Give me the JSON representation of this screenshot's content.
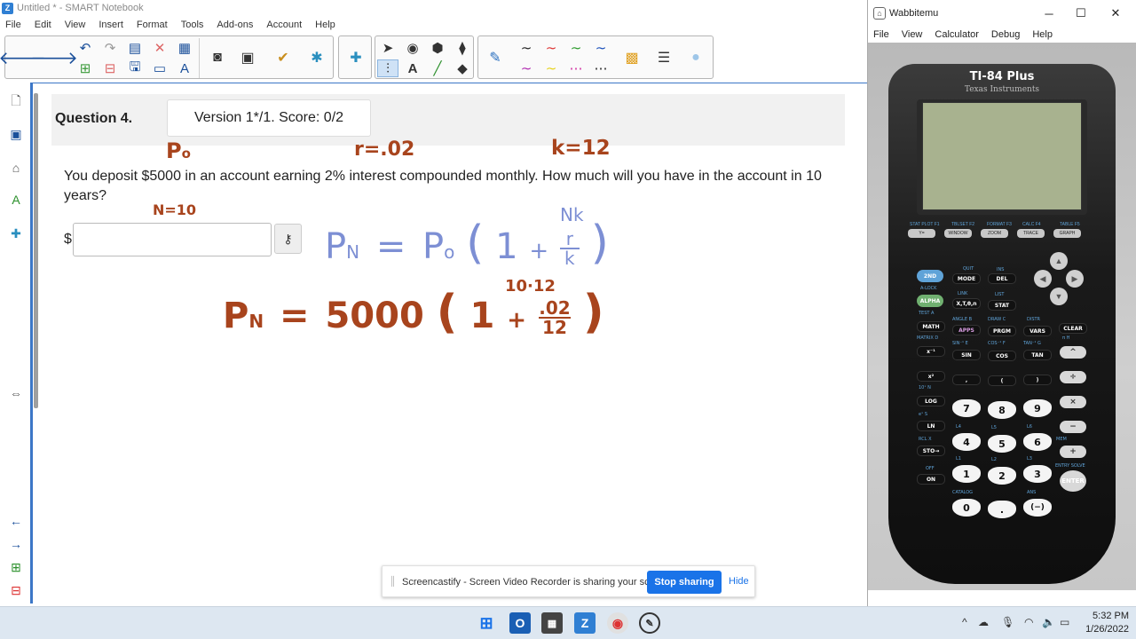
{
  "notebook": {
    "title": "Untitled * - SMART Notebook",
    "menu": [
      "File",
      "Edit",
      "View",
      "Insert",
      "Format",
      "Tools",
      "Add-ons",
      "Account",
      "Help"
    ]
  },
  "question": {
    "title": "Question 4.",
    "version": "Version 1*/1. Score: 0/2",
    "text": "You deposit $5000 in an account earning 2% interest compounded monthly. How much will you have in the account in 10 years?",
    "currency": "$",
    "answer_value": "",
    "key_icon": "key-icon"
  },
  "annotations": {
    "p0": "P",
    "p0_sub": "o",
    "r": "r=.02",
    "k": "k=12",
    "n": "N=10",
    "formula": {
      "lhs": "P",
      "lhs_sub": "N",
      "eq": "=",
      "p": "P",
      "p_sub": "o",
      "open": "(",
      "one": "1",
      "plus": "+",
      "num": "r",
      "den": "k",
      "close": ")",
      "exp": "Nk"
    },
    "sub": {
      "lhs": "P",
      "lhs_sub": "N",
      "eq": "=",
      "principal": "5000",
      "open": "(",
      "one": "1",
      "plus": "+",
      "num": ".02",
      "den": "12",
      "close": ")",
      "exp": "10·12"
    }
  },
  "wabbitemu": {
    "title": "Wabbitemu",
    "menu": [
      "File",
      "View",
      "Calculator",
      "Debug",
      "Help"
    ],
    "model": "TI-84 Plus",
    "brand": "Texas Instruments",
    "fkeys": [
      "Y=",
      "WINDOW",
      "ZOOM",
      "TRACE",
      "GRAPH"
    ],
    "fkey_labels": [
      "STAT PLOT F1",
      "TBLSET F2",
      "FORMAT F3",
      "CALC F4",
      "TABLE F5"
    ],
    "keys": {
      "second": "2ND",
      "mode": "MODE",
      "del": "DEL",
      "alpha": "ALPHA",
      "xton": "X,T,θ,n",
      "stat": "STAT",
      "math": "MATH",
      "apps": "APPS",
      "prgm": "PRGM",
      "vars": "VARS",
      "clear": "CLEAR",
      "sin": "SIN",
      "cos": "COS",
      "tan": "TAN",
      "log": "LOG",
      "ln": "LN",
      "sto": "STO→",
      "on": "ON",
      "n7": "7",
      "n8": "8",
      "n9": "9",
      "n4": "4",
      "n5": "5",
      "n6": "6",
      "n1": "1",
      "n2": "2",
      "n3": "3",
      "n0": "0",
      "dot": ".",
      "neg": "(−)",
      "enter": "ENTER",
      "quit": "QUIT",
      "ins": "INS",
      "alock": "A-LOCK",
      "link": "LINK",
      "list": "LIST",
      "test": "TEST A",
      "angle": "ANGLE B",
      "draw": "DRAW C",
      "distr": "DISTR",
      "matrix": "MATRIX D",
      "sininv": "SIN⁻¹ E",
      "cosinv": "COS⁻¹ F",
      "taninv": "TAN⁻¹ G",
      "pi": "π H",
      "x2": "x²",
      "x1": "x⁻¹",
      "comma": ",",
      "lparen": "(",
      "rparen": ")",
      "off": "OFF",
      "catalog": "CATALOG",
      "ans": "ANS",
      "mem": "MEM",
      "entrysolve": "ENTRY SOLVE",
      "l4": "L4",
      "l5": "L5",
      "l6": "L6",
      "l1": "L1",
      "l2": "L2",
      "l3": "L3",
      "rcl": "RCL X",
      "ex": "eˣ S",
      "tenx": "10ˣ N"
    }
  },
  "share_banner": {
    "message": "Screencastify - Screen Video Recorder is sharing your screen.",
    "stop_label": "Stop sharing",
    "hide_label": "Hide"
  },
  "taskbar": {
    "time": "5:32 PM",
    "date": "1/26/2022",
    "tray_chevron": "^"
  }
}
